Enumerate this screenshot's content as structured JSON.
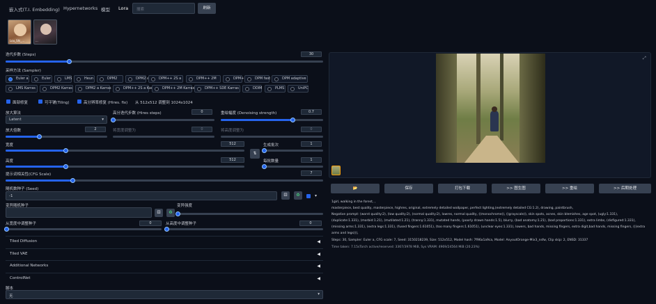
{
  "tabs": [
    "嵌入式(T.I. Embedding)",
    "Hypernetworks",
    "模型",
    "Lora"
  ],
  "search": {
    "placeholder": "搜索",
    "button": "刷新"
  },
  "lora_cards": [
    {
      "name": "Lou_Shi_..."
    },
    {
      "name": "..."
    }
  ],
  "steps": {
    "label": "迭代步数 (Steps)",
    "value": "30",
    "fraction": 0.2
  },
  "sampler": {
    "label": "采样方法 (Sampler)",
    "row1": [
      "Euler a",
      "Euler",
      "LMS",
      "Heun",
      "DPM2",
      "DPM2 a",
      "DPM++ 2S a",
      "DPM++ 2M",
      "DPM++ SDE",
      "DPM fast",
      "DPM adaptive"
    ],
    "row2": [
      "LMS Karras",
      "DPM2 Karras",
      "DPM2 a Karras",
      "DPM++ 2S a Karras",
      "DPM++ 2M Karras",
      "DPM++ SDE Karras",
      "DDIM",
      "PLMS",
      "UniPC"
    ],
    "selected": "Euler a"
  },
  "checkboxes": [
    "面部修复",
    "可平铺(Tiling)",
    "高分辨率修复 (Hires. fix)"
  ],
  "upscale_note": "从 512x512 调整到 1024x1024",
  "upscaler": {
    "label": "放大算法",
    "value": "Latent"
  },
  "hires_steps": {
    "label": "高分迭代步数 (Hires steps)",
    "value": "0",
    "fraction": 0
  },
  "denoise": {
    "label": "重绘幅度 (Denoising strength)",
    "value": "0.7",
    "fraction": 0.7
  },
  "upscale_by": {
    "label": "放大倍数",
    "value": "2",
    "fraction": 0.33
  },
  "resize_w": {
    "label": "将宽度调整为",
    "value": "0"
  },
  "resize_h": {
    "label": "将高度调整为",
    "value": "0"
  },
  "width": {
    "label": "宽度",
    "value": "512",
    "fraction": 0.25
  },
  "height": {
    "label": "高度",
    "value": "512",
    "fraction": 0.25
  },
  "swap_icon": "swap-icon",
  "batch_count": {
    "label": "生成批次",
    "value": "1"
  },
  "batch_size": {
    "label": "每批数量",
    "value": "1"
  },
  "cfg": {
    "label": "提示词相关性(CFG Scale)",
    "value": "7",
    "fraction": 0.21
  },
  "seed": {
    "label": "随机数种子 (Seed)",
    "value": "-1"
  },
  "var_seed": {
    "label": "变异随机种子",
    "value": ""
  },
  "var_strength": {
    "label": "变异强度",
    "value": "0"
  },
  "seed_resize_w": {
    "label": "从宽度中调整种子",
    "value": "0"
  },
  "seed_resize_h": {
    "label": "从高度中调整种子",
    "value": "0"
  },
  "accordions": [
    "Tiled Diffusion",
    "Tiled VAE",
    "Additional Networks",
    "ControlNet"
  ],
  "script": {
    "label": "脚本",
    "value": "无"
  },
  "image_actions": [
    "📂",
    "保存",
    "打包下载",
    ">> 图生图",
    ">> 重绘",
    ">> 后期处理"
  ],
  "output_text": {
    "prompt": "1girl, walking in the forest, ,",
    "line2": "masterpiece, best quality, masterpiece, highres, original, extremely detailed wallpaper, perfect lighting,(extremely detailed CG:1.2), drawing, paintbrush,",
    "neg1": "Negative prompt: (worst quality:2), (low quality:2), (normal quality:2), lowres, normal quality, ((monochrome)), ((grayscale)), skin spots, acnes, skin blemishes, age spot, (ugly:1.331),",
    "neg2": "(duplicate:1.331), (morbid:1.21), (mutilated:1.21), (tranny:1.331), mutated hands, (poorly drawn hands:1.5), blurry, (bad anatomy:1.21), (bad proportions:1.331), extra limbs, (disfigured:1.331),",
    "neg3": "(missing arms:1.331), (extra legs:1.331), (fused fingers:1.61051), (too many fingers:1.61051), (unclear eyes:1.331), lowers, bad hands, missing fingers, extra digit,bad hands, missing fingers, (((extra",
    "neg4": "arms and legs))),",
    "params": "Steps: 30, Sampler: Euler a, CFG scale: 7, Seed: 3150218239, Size: 512x512, Model hash: 7f96a1a9ca, Model: AnyoutOrange-Mix3_nsfw, Clip skip: 2, ENSD: 31337",
    "time": "Time taken: 7.15sTorch active/reserved: 3367/3978 MiB, Sys VRAM: 4969/24564 MiB (20.23%)"
  },
  "colors": {
    "bg": "#0b0f19",
    "accent": "#2563eb",
    "panel": "#1f2937"
  }
}
